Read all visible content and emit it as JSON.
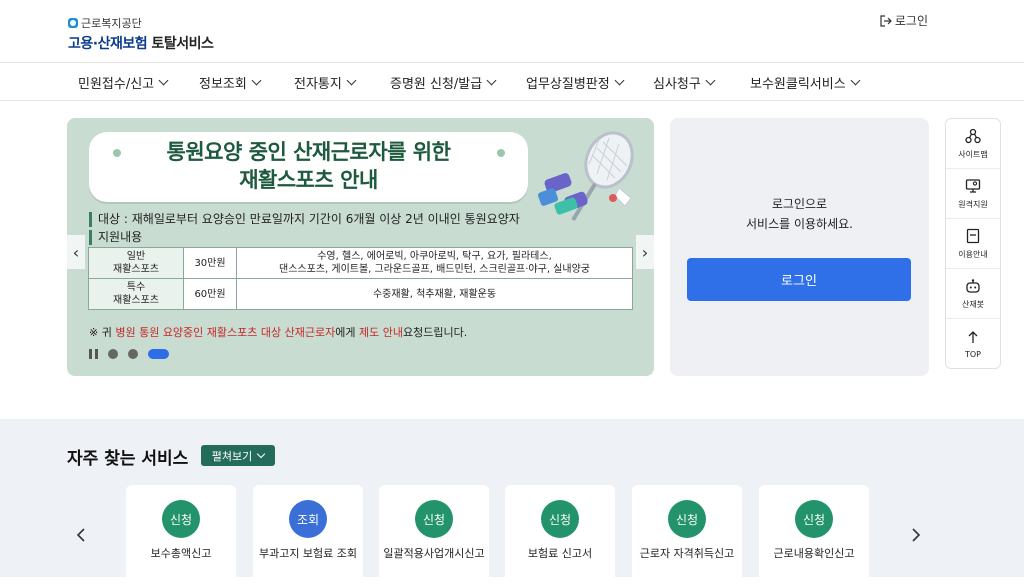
{
  "header": {
    "org_name": "근로복지공단",
    "service_name_blue": "고용·산재보험",
    "service_name_dark": "토탈서비스",
    "login_label": "로그인"
  },
  "nav": {
    "items": [
      {
        "label": "민원접수/신고"
      },
      {
        "label": "정보조회"
      },
      {
        "label": "전자통지"
      },
      {
        "label": "증명원 신청/발급"
      },
      {
        "label": "업무상질병판정"
      },
      {
        "label": "심사청구"
      },
      {
        "label": "보수원클릭서비스"
      }
    ]
  },
  "banner": {
    "title_line1": "통원요양 중인 산재근로자를 위한",
    "title_line2": "재활스포츠 안내",
    "target": "대상 : 재해일로부터 요양승인 만료일까지 기간이 6개월 이상 2년 이내인 통원요양자",
    "support": "지원내용",
    "rows": [
      {
        "category": "일반\n재활스포츠",
        "amount": "30만원",
        "content_line1": "수영, 헬스, 에어로빅, 아쿠아로빅, 탁구, 요가, 필라테스,",
        "content_line2": "댄스스포츠, 게이트볼, 그라운드골프, 배드민턴, 스크린골프·야구, 실내양궁"
      },
      {
        "category": "특수\n재활스포츠",
        "amount": "60만원",
        "content_line1": "수중재활, 척추재활, 재활운동",
        "content_line2": ""
      }
    ],
    "note_prefix": "※ 귀 ",
    "note_red1": "병원 통원 요양중인 재활스포츠 대상 산재근로자",
    "note_mid": "에게 ",
    "note_red2": "제도 안내",
    "note_suffix": "요청드립니다.",
    "prev_icon": "‹",
    "next_icon": "›"
  },
  "login_panel": {
    "message_line1": "로그인으로",
    "message_line2": "서비스를 이용하세요.",
    "button_label": "로그인"
  },
  "quick_menu": [
    {
      "label": "사이트맵",
      "icon": "sitemap-icon"
    },
    {
      "label": "원격지원",
      "icon": "remote-support-icon"
    },
    {
      "label": "이용안내",
      "icon": "guide-icon"
    },
    {
      "label": "산재봇",
      "icon": "chatbot-icon"
    },
    {
      "label": "TOP",
      "icon": "arrow-up-icon"
    }
  ],
  "services": {
    "title": "자주 찾는 서비스",
    "expand_label": "펼쳐보기",
    "cards": [
      {
        "badge": "신청",
        "label": "보수총액신고",
        "color": "#23936b"
      },
      {
        "badge": "조회",
        "label": "부과고지 보험료 조회",
        "color": "#3a6fd8"
      },
      {
        "badge": "신청",
        "label": "일괄적용사업개시신고",
        "color": "#23936b"
      },
      {
        "badge": "신청",
        "label": "보험료 신고서",
        "color": "#23936b"
      },
      {
        "badge": "신청",
        "label": "근로자 자격취득신고",
        "color": "#23936b"
      },
      {
        "badge": "신청",
        "label": "근로내용확인신고",
        "color": "#23936b"
      }
    ]
  },
  "colors": {
    "brand_blue": "#2f6fe8",
    "banner_bg": "#c8dcd2",
    "badge_green": "#23936b",
    "badge_blue": "#3a6fd8"
  }
}
